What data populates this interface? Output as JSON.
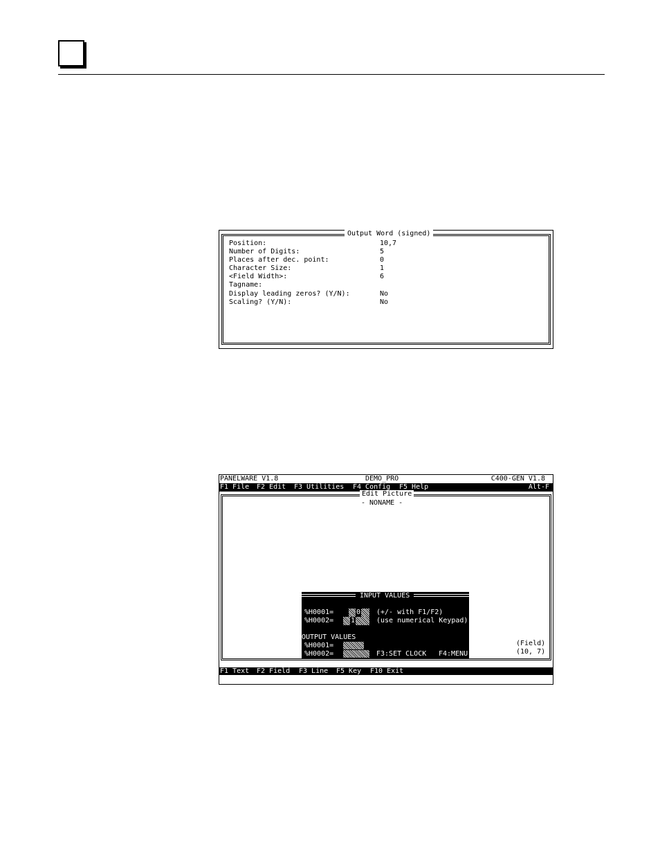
{
  "dialog1": {
    "title": "Output Word (signed)",
    "fields": [
      {
        "label": "Position:",
        "value": "10,7"
      },
      {
        "label": "Number of Digits:",
        "value": "5"
      },
      {
        "label": "Places after dec. point:",
        "value": "0"
      },
      {
        "label": "Character Size:",
        "value": "1"
      },
      {
        "label": "<Field Width>:",
        "value": "6"
      },
      {
        "label": "Tagname:",
        "value": ""
      },
      {
        "label": "Display leading zeros? (Y/N):",
        "value": "No"
      },
      {
        "label": "Scaling? (Y/N):",
        "value": "No"
      }
    ]
  },
  "screen2": {
    "title_left": "PANELWARE V1.8",
    "title_center": "DEMO_PRO",
    "title_right": "C400-GEN V1.8",
    "menu": [
      "F1 File",
      "F2 Edit",
      "F3 Utilities",
      "F4 Config",
      "F5 Help"
    ],
    "menu_right": "Alt-F",
    "edit_title": "Edit Picture",
    "edit_subtitle": "- NONAME -",
    "field_label": "(Field)",
    "field_coords": "(10, 7)",
    "popup": {
      "input_title": "INPUT VALUES",
      "in1_label": "%H0001=",
      "in1_value": "0",
      "in1_hint": "(+/- with F1/F2)",
      "in2_label": "%H0002=",
      "in2_value": "1",
      "in2_hint": "(use numerical Keypad)",
      "output_title": "OUTPUT VALUES",
      "out1_label": "%H0001=",
      "out2_label": "%H0002=",
      "f3_label": "F3:SET CLOCK",
      "f4_label": "F4:MENU"
    },
    "bottom_menu": [
      "F1 Text",
      "F2 Field",
      "F3 Line",
      "F5 Key",
      "F10 Exit"
    ]
  }
}
